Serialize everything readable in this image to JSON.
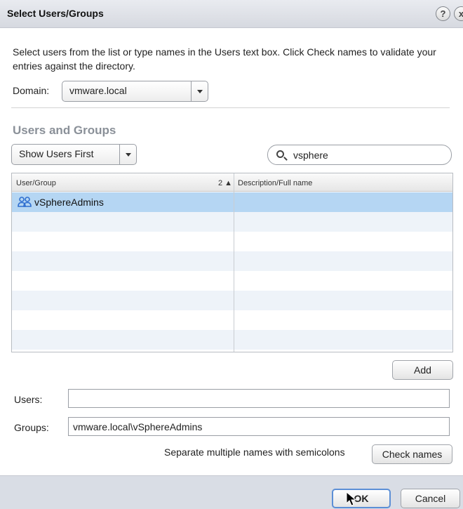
{
  "dialog": {
    "title": "Select Users/Groups",
    "help_glyph": "?",
    "close_glyph": "x"
  },
  "intro_text": "Select users from the list or type names in the Users text box. Click Check names to validate your entries against the directory.",
  "domain": {
    "label": "Domain:",
    "value": "vmware.local"
  },
  "users_groups": {
    "section_title": "Users and Groups",
    "sort_value": "Show Users First",
    "search_value": "vsphere"
  },
  "grid": {
    "columns": {
      "user_group": "User/Group",
      "sort_indicator": "2 ▲",
      "description": "Description/Full name"
    },
    "rows": [
      {
        "name": "vSphereAdmins",
        "description": "",
        "icon": "group-icon",
        "selected": true
      }
    ]
  },
  "add_button": "Add",
  "users_field": {
    "label": "Users:",
    "value": ""
  },
  "groups_field": {
    "label": "Groups:",
    "value": "vmware.local\\vSphereAdmins"
  },
  "hint": "Separate multiple names with semicolons",
  "check_names_button": "Check names",
  "footer": {
    "ok": "OK",
    "cancel": "Cancel"
  },
  "colors": {
    "selection": "#b5d6f3",
    "stripe": "#eef3f9",
    "footer": "#d9dde5"
  }
}
